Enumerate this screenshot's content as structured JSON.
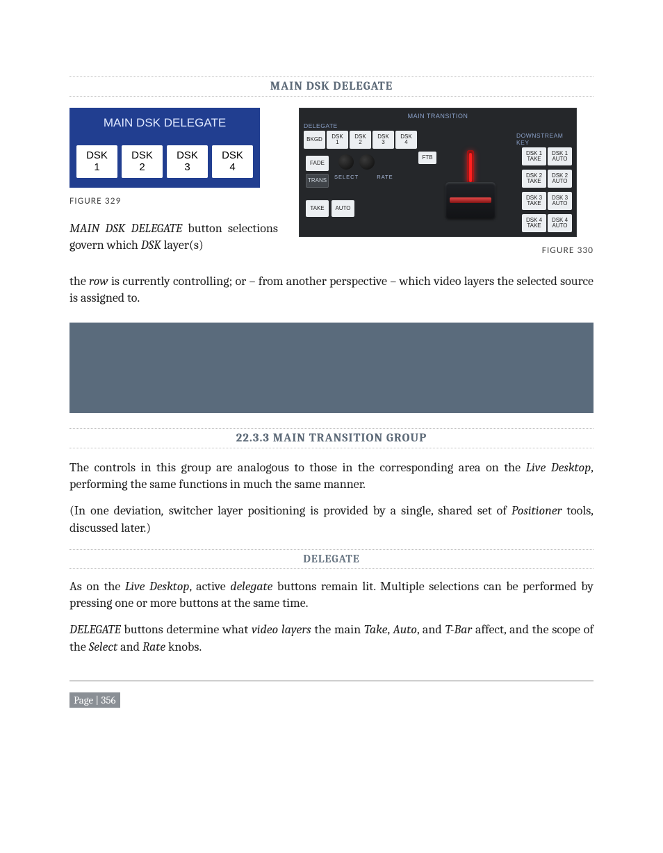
{
  "headings": {
    "main_dsk_delegate": "MAIN DSK DELEGATE",
    "main_transition_group": "22.3.3 MAIN TRANSITION GROUP",
    "delegate": "DELEGATE"
  },
  "fig329": {
    "title": "MAIN DSK DELEGATE",
    "buttons": [
      "DSK\n1",
      "DSK\n2",
      "DSK\n3",
      "DSK\n4"
    ],
    "caption": "FIGURE 329"
  },
  "fig330": {
    "top_label": "MAIN TRANSITION",
    "label_delegate": "DELEGATE",
    "label_downstream_key": "DOWNSTREAM KEY",
    "buttons": {
      "bkgd": "BKGD",
      "dsk1": "DSK\n1",
      "dsk2": "DSK\n2",
      "dsk3": "DSK\n3",
      "dsk4": "DSK\n4",
      "fade": "FADE",
      "ftb": "FTB",
      "trans": "TRANS",
      "select": "SELECT",
      "rate": "RATE",
      "take": "TAKE",
      "auto": "AUTO"
    },
    "dsk_keys": [
      {
        "take": "DSK 1\nTAKE",
        "auto": "DSK 1\nAUTO"
      },
      {
        "take": "DSK 2\nTAKE",
        "auto": "DSK 2\nAUTO"
      },
      {
        "take": "DSK 3\nTAKE",
        "auto": "DSK 3\nAUTO"
      },
      {
        "take": "DSK 4\nTAKE",
        "auto": "DSK 4\nAUTO"
      }
    ],
    "caption": "FIGURE 330"
  },
  "paras": {
    "p1a": "MAIN DSK DELEGATE",
    "p1b": " button selections govern which ",
    "p1c": "DSK",
    "p1d": " layer(s)",
    "p2a": "the ",
    "p2b": "row",
    "p2c": " is currently controlling; or – from another perspective – which video layers the selected source is assigned to.",
    "p3a": "The controls in this group are analogous to those in the corresponding area on the ",
    "p3b": "Live Desktop",
    "p3c": ", performing the same functions in much the same manner.",
    "p4a": "(In one deviation",
    "p4b": ", ",
    "p4c": "switcher layer positioning is provided by a single, shared set of ",
    "p4d": "Positioner",
    "p4e": " tools, discussed later.)",
    "p5a": "As on the ",
    "p5b": "Live Desktop",
    "p5c": ", active ",
    "p5d": "delegate",
    "p5e": " buttons remain lit.  Multiple selections can be performed by pressing one or more buttons at the same time.",
    "p6a": "DELEGATE",
    "p6b": " buttons determine what ",
    "p6c": "video layers",
    "p6d": " the main ",
    "p6e": "Take",
    "p6f": ", ",
    "p6g": "Auto",
    "p6h": ", and ",
    "p6i": "T-Bar",
    "p6j": " affect, and the scope of the ",
    "p6k": "Select",
    "p6l": " and ",
    "p6m": "Rate",
    "p6n": " knobs."
  },
  "footer": {
    "page": "Page | 356"
  }
}
